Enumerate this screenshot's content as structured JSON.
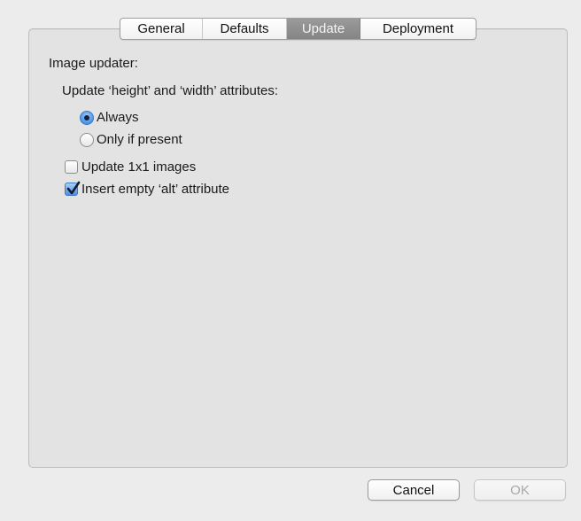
{
  "tabs": [
    {
      "label": "General",
      "selected": false
    },
    {
      "label": "Defaults",
      "selected": false
    },
    {
      "label": "Update",
      "selected": true
    },
    {
      "label": "Deployment",
      "selected": false
    }
  ],
  "panel": {
    "section_label": "Image updater:",
    "subsection_label": "Update ‘height’ and ‘width’ attributes:",
    "radio_always": {
      "label": "Always",
      "checked": true
    },
    "radio_only_if_present": {
      "label": "Only if present",
      "checked": false
    },
    "checkbox_update_1x1": {
      "label": "Update 1x1 images",
      "checked": false
    },
    "checkbox_insert_alt": {
      "label": "Insert empty ‘alt’ attribute",
      "checked": true
    }
  },
  "buttons": {
    "cancel_label": "Cancel",
    "ok_label": "OK",
    "ok_enabled": false
  },
  "colors": {
    "selected_tab": "#8f8f8f",
    "accent_blue": "#4c8fe0",
    "panel_bg": "#e3e3e3",
    "window_bg": "#ececec"
  }
}
